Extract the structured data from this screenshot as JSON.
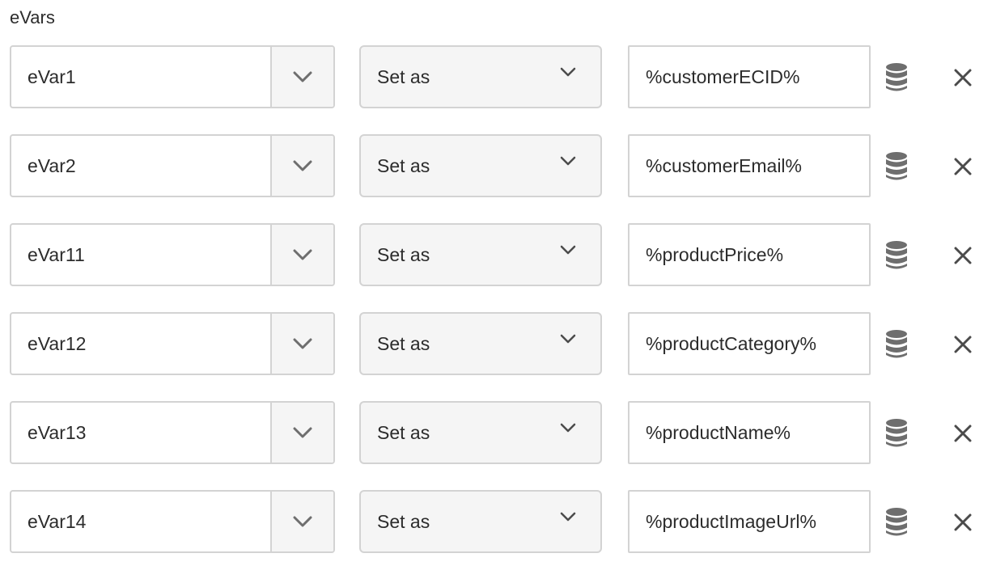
{
  "section": {
    "label": "eVars"
  },
  "rows": [
    {
      "evar": "eVar1",
      "action": "Set as",
      "value": "%customerECID%"
    },
    {
      "evar": "eVar2",
      "action": "Set as",
      "value": "%customerEmail%"
    },
    {
      "evar": "eVar11",
      "action": "Set as",
      "value": "%productPrice%"
    },
    {
      "evar": "eVar12",
      "action": "Set as",
      "value": "%productCategory%"
    },
    {
      "evar": "eVar13",
      "action": "Set as",
      "value": "%productName%"
    },
    {
      "evar": "eVar14",
      "action": "Set as",
      "value": "%productImageUrl%"
    }
  ],
  "icons": {
    "combo_toggle": "chevron-down-icon",
    "select_toggle": "chevron-down-icon",
    "data_element": "database-icon",
    "remove": "close-icon"
  },
  "colors": {
    "border": "#d3d3d3",
    "field_bg": "#ffffff",
    "button_bg": "#f5f5f5",
    "icon": "#6e6e6e",
    "text": "#2c2c2c"
  }
}
